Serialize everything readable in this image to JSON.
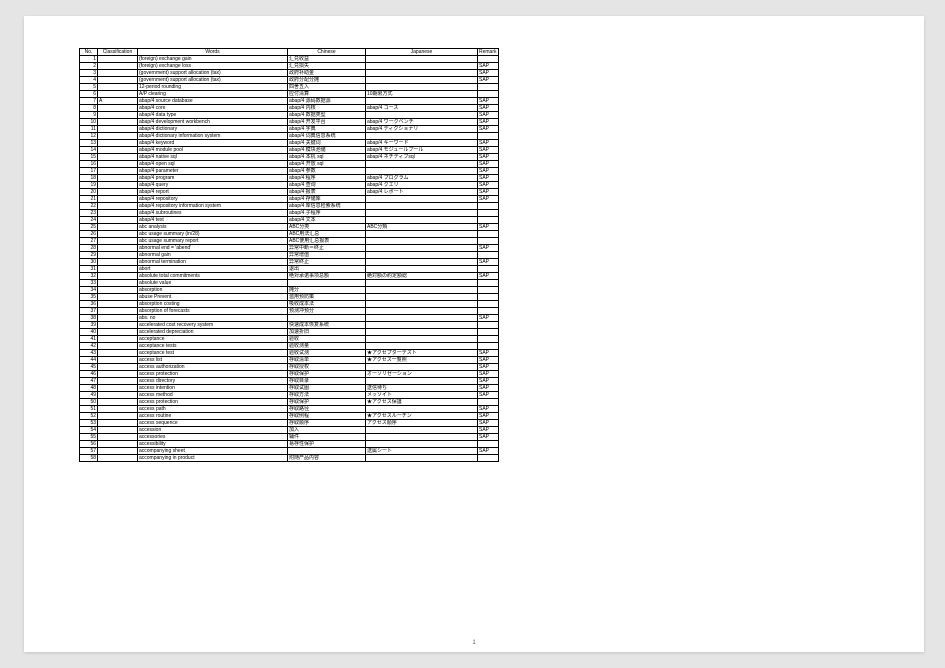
{
  "pageNumber": "1",
  "columns": [
    "No.",
    "Classification",
    "Words",
    "Chinese",
    "Japanese",
    "Remark"
  ],
  "rows": [
    {
      "no": 1,
      "cls": "",
      "w": "(foreign) exchange gain",
      "cn": "汇兑收益",
      "jp": "",
      "rm": ""
    },
    {
      "no": 2,
      "cls": "",
      "w": "(foreign) exchange loss",
      "cn": "汇兑损失",
      "jp": "",
      "rm": "SAP"
    },
    {
      "no": 3,
      "cls": "",
      "w": "(government) support allocation (tax)",
      "cn": "政府补助金",
      "jp": "",
      "rm": "SAP"
    },
    {
      "no": 4,
      "cls": "",
      "w": "(government) support allocation (tax)",
      "cn": "政府分配分摊",
      "jp": "",
      "rm": "SAP"
    },
    {
      "no": 5,
      "cls": "",
      "w": "12-period rounding",
      "cn": "四舍五入",
      "jp": "",
      "rm": ""
    },
    {
      "no": 6,
      "cls": "",
      "w": "A/P clearing",
      "cn": "应付清算",
      "jp": "10期限方式",
      "rm": ""
    },
    {
      "no": 7,
      "cls": "A",
      "w": "abap/4 source database",
      "cn": "abap/4 源码数据源",
      "jp": "",
      "rm": "SAP"
    },
    {
      "no": 8,
      "cls": "",
      "w": "abap/4 core",
      "cn": "abap/4 内核",
      "jp": "abap/4 コース",
      "rm": "SAP"
    },
    {
      "no": 9,
      "cls": "",
      "w": "abap/4 data type",
      "cn": "abap/4 数据类型",
      "jp": "",
      "rm": "SAP"
    },
    {
      "no": 10,
      "cls": "",
      "w": "abap/4 development workbench",
      "cn": "abap/4 开发平台",
      "jp": "abap/4 ワークベンチ",
      "rm": "SAP"
    },
    {
      "no": 11,
      "cls": "",
      "w": "abap/4 dictionary",
      "cn": "abap/4 字典",
      "jp": "abap/4 ディクショナリ",
      "rm": "SAP"
    },
    {
      "no": 12,
      "cls": "",
      "w": "abap/4 dictionary information system",
      "cn": "abap/4 词典信息系统",
      "jp": "",
      "rm": ""
    },
    {
      "no": 13,
      "cls": "",
      "w": "abap/4 keyword",
      "cn": "abap/4 关键词",
      "jp": "abap/4 キーワード",
      "rm": "SAP"
    },
    {
      "no": 14,
      "cls": "",
      "w": "abap/4 module pool",
      "cn": "abap/4 模块池储",
      "jp": "abap/4 モジュールプール",
      "rm": "SAP"
    },
    {
      "no": 15,
      "cls": "",
      "w": "abap/4 native sql",
      "cn": "abap/4 本机 sql",
      "jp": "abap/4 ネチティブsql",
      "rm": "SAP"
    },
    {
      "no": 16,
      "cls": "",
      "w": "abap/4 open sql",
      "cn": "abap/4 开放 sql",
      "jp": "",
      "rm": "SAP"
    },
    {
      "no": 17,
      "cls": "",
      "w": "abap/4 parameter",
      "cn": "abap/4 参数",
      "jp": "",
      "rm": "SAP"
    },
    {
      "no": 18,
      "cls": "",
      "w": "abap/4 program",
      "cn": "abap/4 程序",
      "jp": "abap/4 プログラム",
      "rm": "SAP"
    },
    {
      "no": 19,
      "cls": "",
      "w": "abap/4 query",
      "cn": "abap/4 查询",
      "jp": "abap/4 クエリ",
      "rm": "SAP"
    },
    {
      "no": 20,
      "cls": "",
      "w": "abap/4 report",
      "cn": "abap/4 报表",
      "jp": "abap/4 レポート",
      "rm": "SAP"
    },
    {
      "no": 21,
      "cls": "",
      "w": "abap/4 repository",
      "cn": "abap/4 存储库",
      "jp": "",
      "rm": "SAP"
    },
    {
      "no": 22,
      "cls": "",
      "w": "abap/4 repository information system",
      "cn": "abap/4 库信息检索系统",
      "jp": "",
      "rm": ""
    },
    {
      "no": 23,
      "cls": "",
      "w": "abap/4 subroutines",
      "cn": "abap/4 子程序",
      "jp": "",
      "rm": ""
    },
    {
      "no": 24,
      "cls": "",
      "w": "abap/4 text",
      "cn": "abap/4 文本",
      "jp": "",
      "rm": ""
    },
    {
      "no": 25,
      "cls": "",
      "w": "abc analysis",
      "cn": "ABC分类",
      "jp": "ABC分類",
      "rm": "SAP"
    },
    {
      "no": 26,
      "cls": "",
      "w": "abc usage summary (in/28)",
      "cn": "ABC用法汇总",
      "jp": "",
      "rm": ""
    },
    {
      "no": 27,
      "cls": "",
      "w": "abc usage summary report",
      "cn": "ABC使用汇总报表",
      "jp": "",
      "rm": ""
    },
    {
      "no": 28,
      "cls": "",
      "w": "abnormal end = 'abend'",
      "cn": "异常中断＝终止",
      "jp": "",
      "rm": "SAP"
    },
    {
      "no": 29,
      "cls": "",
      "w": "abnormal gain",
      "cn": "异常增值",
      "jp": "",
      "rm": ""
    },
    {
      "no": 30,
      "cls": "",
      "w": "abnormal termination",
      "cn": "异常终止",
      "jp": "",
      "rm": "SAP"
    },
    {
      "no": 31,
      "cls": "",
      "w": "abort",
      "cn": "退出",
      "jp": "",
      "rm": ""
    },
    {
      "no": 32,
      "cls": "",
      "w": "absolute total commitments",
      "cn": "绝对承诺事项总额",
      "jp": "絶対額の約定額総",
      "rm": "SAP"
    },
    {
      "no": 33,
      "cls": "",
      "w": "absolute value",
      "cn": "",
      "jp": "",
      "rm": ""
    },
    {
      "no": 34,
      "cls": "",
      "w": "absorption",
      "cn": "摊分",
      "jp": "",
      "rm": ""
    },
    {
      "no": 35,
      "cls": "",
      "w": "abuse Prevent",
      "cn": "滥用预防策",
      "jp": "",
      "rm": ""
    },
    {
      "no": 36,
      "cls": "",
      "w": "absorption costing",
      "cn": "吸收成本法",
      "jp": "",
      "rm": ""
    },
    {
      "no": 37,
      "cls": "",
      "w": "absorption of forecasts",
      "cn": "预测冲预分",
      "jp": "",
      "rm": ""
    },
    {
      "no": 38,
      "cls": "",
      "w": "abs.  no",
      "cn": "",
      "jp": "",
      "rm": "SAP"
    },
    {
      "no": 39,
      "cls": "",
      "w": "accelerated cost recovery system",
      "cn": "快速成本恢复系统",
      "jp": "",
      "rm": ""
    },
    {
      "no": 40,
      "cls": "",
      "w": "accelerated depreciation",
      "cn": "加速折旧",
      "jp": "",
      "rm": ""
    },
    {
      "no": 41,
      "cls": "",
      "w": "acceptance",
      "cn": "验收",
      "jp": "",
      "rm": ""
    },
    {
      "no": 42,
      "cls": "",
      "w": "acceptance tests",
      "cn": "验收测量",
      "jp": "",
      "rm": ""
    },
    {
      "no": 43,
      "cls": "",
      "w": "acceptance test",
      "cn": "验收试测",
      "jp": "★アクセプターテスト",
      "rm": "SAP"
    },
    {
      "no": 44,
      "cls": "",
      "w": "access  list",
      "cn": "存取清单",
      "jp": "★アクセス一覧照",
      "rm": "SAP"
    },
    {
      "no": 45,
      "cls": "",
      "w": "access authorization",
      "cn": "存取授权",
      "jp": "",
      "rm": "SAP"
    },
    {
      "no": 46,
      "cls": "",
      "w": "access protection",
      "cn": "存取保护",
      "jp": "オーソリゼーション",
      "rm": "SAP"
    },
    {
      "no": 47,
      "cls": "",
      "w": "access directory",
      "cn": "存取目录",
      "jp": "",
      "rm": "SAP"
    },
    {
      "no": 48,
      "cls": "",
      "w": "access intention",
      "cn": "存取试图",
      "jp": "送信待ち",
      "rm": "SAP"
    },
    {
      "no": 49,
      "cls": "",
      "w": "access method",
      "cn": "存取方法",
      "jp": "メッソイト",
      "rm": "SAP"
    },
    {
      "no": 50,
      "cls": "",
      "w": "access protection",
      "cn": "存取保护",
      "jp": "★アクセス保護",
      "rm": ""
    },
    {
      "no": 51,
      "cls": "",
      "w": "access path",
      "cn": "存取路径",
      "jp": "",
      "rm": "SAP"
    },
    {
      "no": 52,
      "cls": "",
      "w": "access routine",
      "cn": "存取例程",
      "jp": "★アクセスルーチン",
      "rm": "SAP"
    },
    {
      "no": 53,
      "cls": "",
      "w": "access sequence",
      "cn": "存取顺序",
      "jp": "アクセス順序",
      "rm": "SAP"
    },
    {
      "no": 54,
      "cls": "",
      "w": "accession",
      "cn": "加入",
      "jp": "",
      "rm": "SAP"
    },
    {
      "no": 55,
      "cls": "",
      "w": "accessories",
      "cn": "辅件",
      "jp": "",
      "rm": "SAP"
    },
    {
      "no": 56,
      "cls": "",
      "w": "accessibility",
      "cn": "易存性保护",
      "jp": "",
      "rm": ""
    },
    {
      "no": 57,
      "cls": "",
      "w": "accompanying sheet",
      "cn": "",
      "jp": "送属シート",
      "rm": "SAP"
    },
    {
      "no": 58,
      "cls": "",
      "w": "accompanying in product",
      "cn": "附随产品内容",
      "jp": "",
      "rm": ""
    }
  ]
}
